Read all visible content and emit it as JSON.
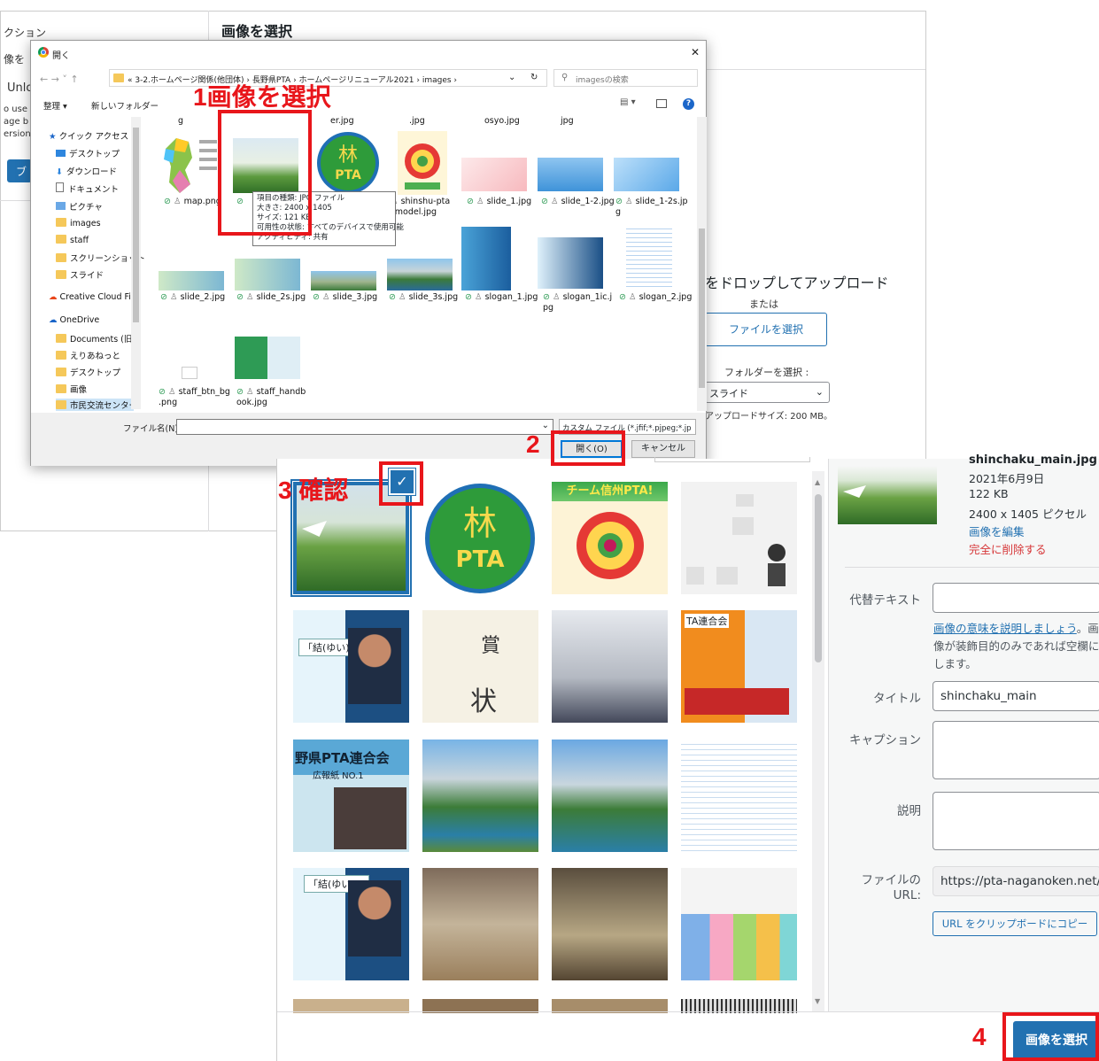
{
  "wp_background": {
    "side_texts": [
      "クション",
      "像を",
      "Unlo",
      "o use",
      "age b",
      "ersion",
      "ブ"
    ],
    "page_title": "画像を選択",
    "upload_drop_text": "をドロップしてアップロード",
    "or_text": "または",
    "select_file_button": "ファイルを選択",
    "folder_label": "フォルダーを選択 :",
    "folder_value": "スライド",
    "max_upload_text": "アップロードサイズ: 200 MB。"
  },
  "file_dialog": {
    "title": "開く",
    "close_glyph": "✕",
    "breadcrumb": "« 3-2.ホームページ関係(他団体) › 長野県PTA › ホームページリニューアル2021 › images ›",
    "search_placeholder": "imagesの検索",
    "toolbar": {
      "organize": "整理 ▾",
      "new_folder": "新しいフォルダー"
    },
    "nav_items": [
      {
        "label": "クイック アクセス",
        "type": "star"
      },
      {
        "label": "デスクトップ",
        "type": "desktop"
      },
      {
        "label": "ダウンロード",
        "type": "download"
      },
      {
        "label": "ドキュメント",
        "type": "doc"
      },
      {
        "label": "ピクチャ",
        "type": "pic"
      },
      {
        "label": "images",
        "type": "folder"
      },
      {
        "label": "staff",
        "type": "folder"
      },
      {
        "label": "スクリーンショット",
        "type": "folder"
      },
      {
        "label": "スライド",
        "type": "folder"
      },
      {
        "label": "Creative Cloud File",
        "type": "cc"
      },
      {
        "label": "OneDrive",
        "type": "cloud"
      },
      {
        "label": "Documents (旧",
        "type": "folder"
      },
      {
        "label": "えりあねっと",
        "type": "folder"
      },
      {
        "label": "デスクトップ",
        "type": "folder"
      },
      {
        "label": "画像",
        "type": "folder"
      },
      {
        "label": "市民交流センター",
        "type": "folder"
      }
    ],
    "top_row_labels": [
      "g",
      "er.jpg",
      ".jpg",
      "osyo.jpg",
      "jpg"
    ],
    "files": [
      {
        "name": "map.png",
        "kind": "map"
      },
      {
        "name": "",
        "kind": "green"
      },
      {
        "name": "",
        "kind": "pta"
      },
      {
        "name": "shinshu-pta\n_model.jpg",
        "kind": "apple"
      },
      {
        "name": "slide_1.jpg",
        "kind": "hands"
      },
      {
        "name": "slide_1-2.jpg",
        "kind": "sky"
      },
      {
        "name": "slide_1-2s.jp\ng",
        "kind": "hands2"
      },
      {
        "name": "slide_2.jpg",
        "kind": "fence"
      },
      {
        "name": "slide_2s.jpg",
        "kind": "fence"
      },
      {
        "name": "slide_3.jpg",
        "kind": "mount"
      },
      {
        "name": "slide_3s.jpg",
        "kind": "mount"
      },
      {
        "name": "slogan_1.jpg",
        "kind": "slogan"
      },
      {
        "name": "slogan_1ic.j\npg",
        "kind": "slogan2"
      },
      {
        "name": "slogan_2.jpg",
        "kind": "doc"
      },
      {
        "name": "staff_btn_bg\n.png",
        "kind": "blank"
      },
      {
        "name": "staff_handb\nook.jpg",
        "kind": "handbook"
      }
    ],
    "tooltip": [
      "項目の種類: JPG ファイル",
      "大きさ: 2400 x 1405",
      "サイズ: 121 KB",
      "可用性の状態: すべてのデバイスで使用可能",
      "アクティビティ: 共有"
    ],
    "filename_label": "ファイル名(N):",
    "filetype_value": "カスタム ファイル (*.jfif;*.pjpeg;*.jp",
    "open_button": "開く(O)",
    "cancel_button": "キャンセル"
  },
  "annotations": {
    "step1": "1画像を選択",
    "step2": "2",
    "step3": "3 確認",
    "step4": "4"
  },
  "media_modal": {
    "detail": {
      "filename": "shinchaku_main.jpg",
      "date": "2021年6月9日",
      "size": "122 KB",
      "dimensions": "2400 x 1405 ピクセル",
      "edit_link": "画像を編集",
      "delete_link": "完全に削除する"
    },
    "fields": {
      "alt_label": "代替テキスト",
      "alt_help_link": "画像の意味を説明しましょう",
      "alt_help_text": "画像が装飾目的のみであれば空欄にします。",
      "title_label": "タイトル",
      "title_value": "shinchaku_main",
      "caption_label": "キャプション",
      "description_label": "説明",
      "url_label": "ファイルの URL:",
      "url_value": "https://pta-naganoken.net/",
      "copy_button": "URL をクリップボードにコピー"
    },
    "select_button": "画像を選択",
    "grid_texts": {
      "apple_title": "チーム信州PTA!",
      "pta_logo": "PTA",
      "yui": "「結(ゆい)」",
      "award": "賞",
      "award2": "状",
      "rengokai": "TA連合会",
      "news": "野県PTA連合会",
      "news2": "広報紙 NO.1"
    }
  },
  "colors": {
    "accent": "#2271b1",
    "red": "#e8161b",
    "button_blue": "#2271b1"
  }
}
